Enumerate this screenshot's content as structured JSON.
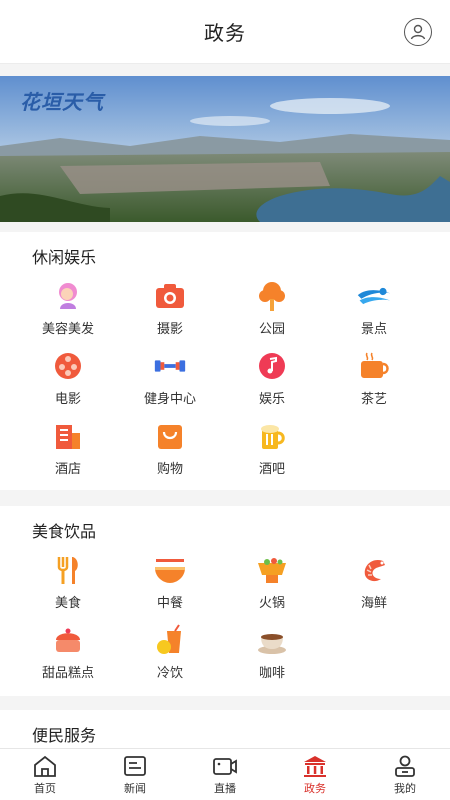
{
  "header": {
    "title": "政务"
  },
  "banner": {
    "logo_text": "花垣天气"
  },
  "sections": {
    "leisure": {
      "title": "休闲娱乐",
      "items": [
        {
          "label": "美容美发",
          "icon": "beauty-icon"
        },
        {
          "label": "摄影",
          "icon": "camera-icon"
        },
        {
          "label": "公园",
          "icon": "park-icon"
        },
        {
          "label": "景点",
          "icon": "scenic-icon"
        },
        {
          "label": "电影",
          "icon": "film-icon"
        },
        {
          "label": "健身中心",
          "icon": "dumbbell-icon"
        },
        {
          "label": "娱乐",
          "icon": "music-icon"
        },
        {
          "label": "茶艺",
          "icon": "tea-icon"
        },
        {
          "label": "酒店",
          "icon": "hotel-icon"
        },
        {
          "label": "购物",
          "icon": "shopping-icon"
        },
        {
          "label": "酒吧",
          "icon": "beer-icon"
        }
      ]
    },
    "food": {
      "title": "美食饮品",
      "items": [
        {
          "label": "美食",
          "icon": "fork-knife-icon"
        },
        {
          "label": "中餐",
          "icon": "noodle-bowl-icon"
        },
        {
          "label": "火锅",
          "icon": "hotpot-icon"
        },
        {
          "label": "海鲜",
          "icon": "shrimp-icon"
        },
        {
          "label": "甜品糕点",
          "icon": "cake-icon"
        },
        {
          "label": "冷饮",
          "icon": "cold-drink-icon"
        },
        {
          "label": "咖啡",
          "icon": "coffee-icon"
        }
      ]
    },
    "services": {
      "title": "便民服务"
    }
  },
  "tabbar": {
    "tabs": [
      {
        "label": "首页",
        "icon": "home-icon"
      },
      {
        "label": "新闻",
        "icon": "news-icon"
      },
      {
        "label": "直播",
        "icon": "video-icon"
      },
      {
        "label": "政务",
        "icon": "government-icon",
        "active": true
      },
      {
        "label": "我的",
        "icon": "user-icon"
      }
    ]
  },
  "colors": {
    "accent": "#d9312b",
    "orange": "#f5822a"
  }
}
